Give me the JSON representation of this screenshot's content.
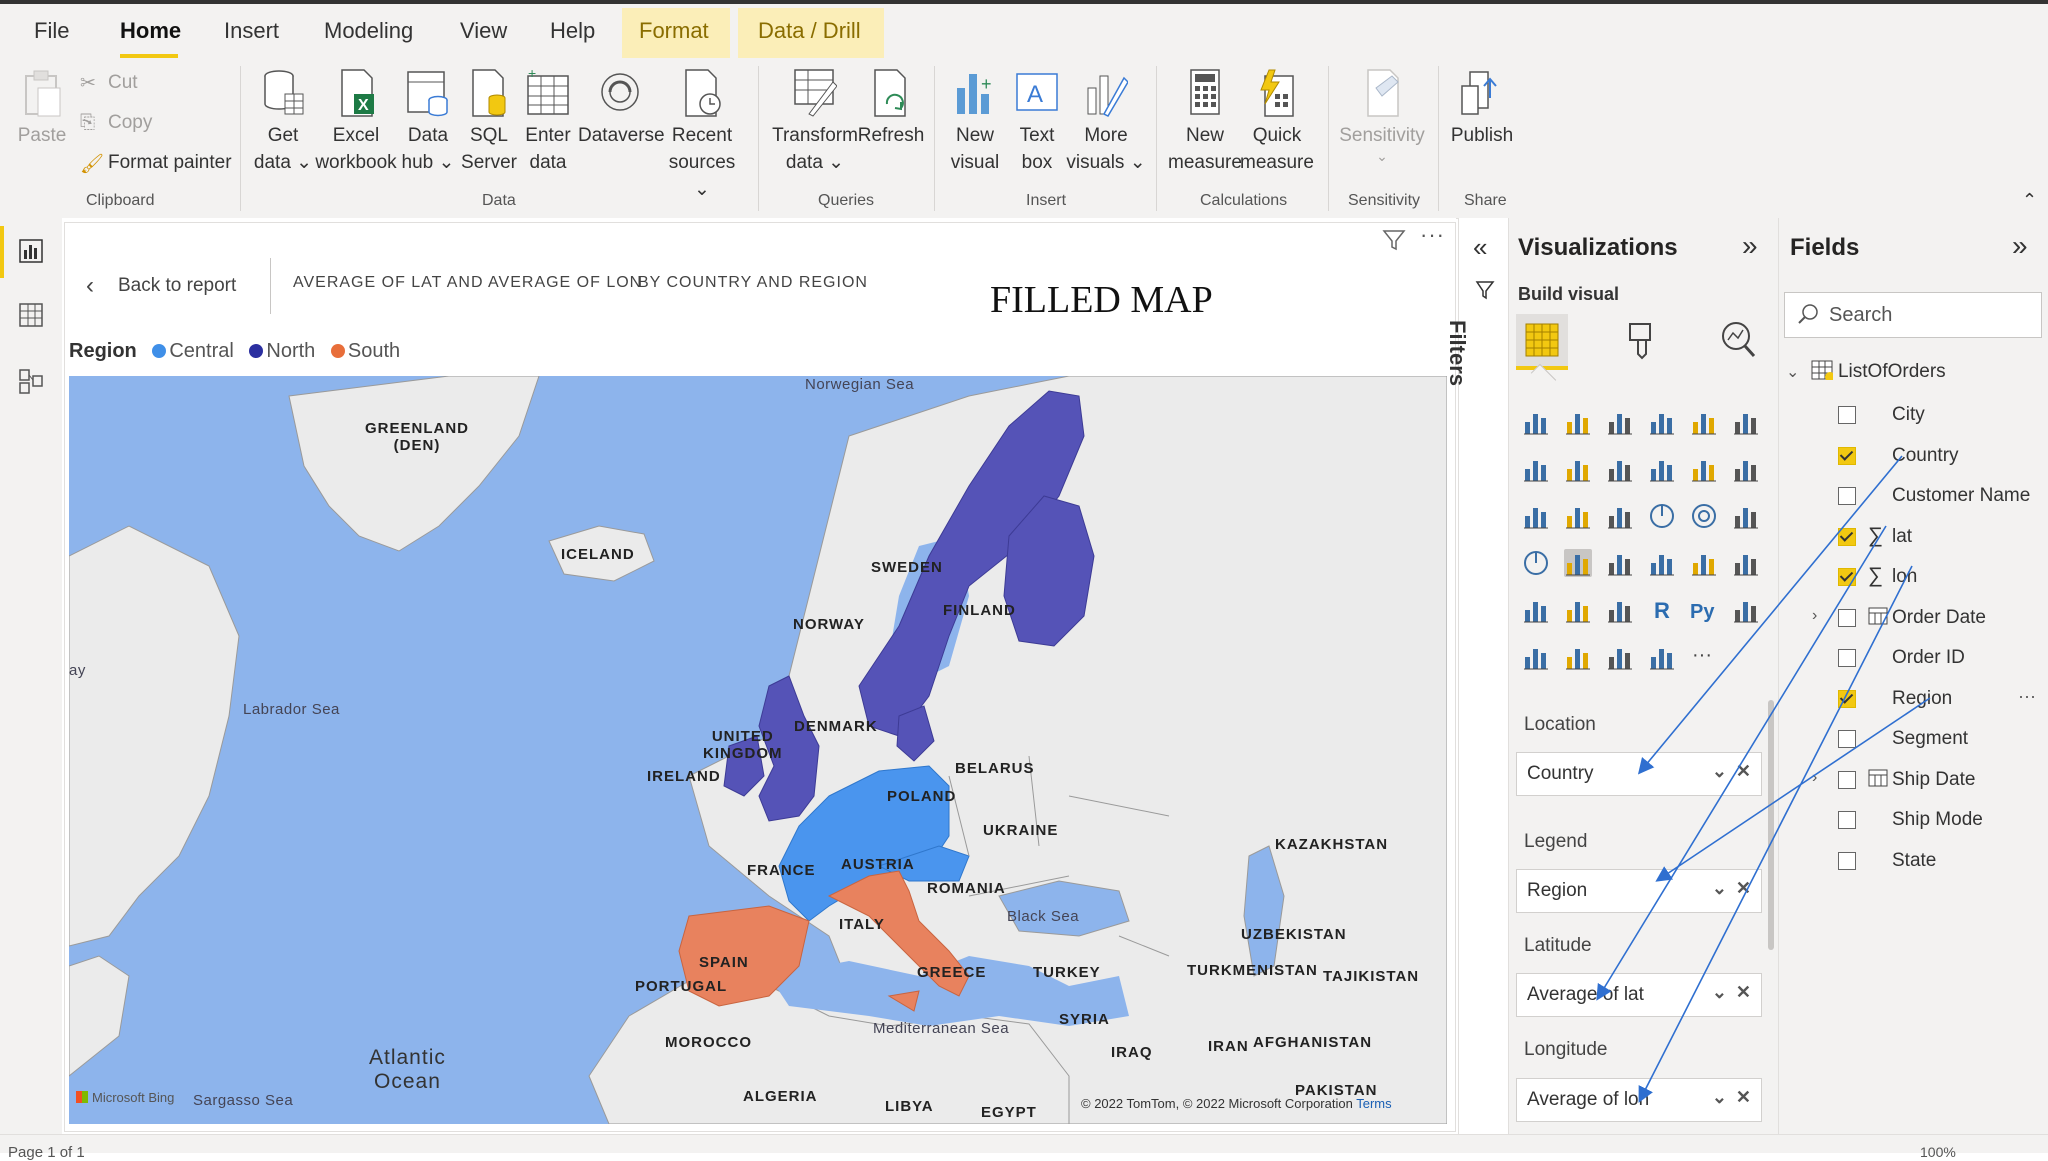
{
  "menu": {
    "items": [
      "File",
      "Home",
      "Insert",
      "Modeling",
      "View",
      "Help",
      "Format",
      "Data / Drill"
    ],
    "active": "Home"
  },
  "ribbon": {
    "clipboard": {
      "paste": "Paste",
      "cut": "Cut",
      "copy": "Copy",
      "format_painter": "Format painter",
      "label": "Clipboard"
    },
    "data": {
      "get_data": [
        "Get",
        "data ⌄"
      ],
      "excel": [
        "Excel",
        "workbook"
      ],
      "data_hub": [
        "Data",
        "hub ⌄"
      ],
      "sql": [
        "SQL",
        "Server"
      ],
      "enter": [
        "Enter",
        "data"
      ],
      "dataverse": [
        "Dataverse"
      ],
      "recent": [
        "Recent",
        "sources ⌄"
      ],
      "label": "Data"
    },
    "queries": {
      "transform": [
        "Transform",
        "data ⌄"
      ],
      "refresh": [
        "Refresh"
      ],
      "label": "Queries"
    },
    "insert": {
      "new_visual": [
        "New",
        "visual"
      ],
      "text_box": [
        "Text",
        "box"
      ],
      "more_visuals": [
        "More",
        "visuals ⌄"
      ],
      "label": "Insert"
    },
    "calculations": {
      "new_measure": [
        "New",
        "measure"
      ],
      "quick_measure": [
        "Quick",
        "measure"
      ],
      "label": "Calculations"
    },
    "sensitivity": {
      "btn": [
        "Sensitivity",
        "⌄"
      ],
      "label": "Sensitivity"
    },
    "share": {
      "publish": [
        "Publish"
      ],
      "label": "Share"
    }
  },
  "report": {
    "back": "Back to report",
    "crumb1": "AVERAGE OF LAT AND AVERAGE OF LON",
    "crumb2": "BY COUNTRY AND REGION",
    "title": "FILLED MAP",
    "legend_title": "Region",
    "legend": [
      {
        "name": "Central",
        "color": "#3f8fe8"
      },
      {
        "name": "North",
        "color": "#2b2fa0"
      },
      {
        "name": "South",
        "color": "#e86e3a"
      }
    ]
  },
  "map": {
    "colors": {
      "water": "#8db4ec",
      "land": "#ebebeb",
      "north": "#5553b7",
      "central": "#4a95ee",
      "south": "#e8825e",
      "border": "#9a9a9a"
    },
    "labels": {
      "norwegian_sea": "Norwegian Sea",
      "greenland": "GREENLAND\n(DEN)",
      "iceland": "ICELAND",
      "sweden": "SWEDEN",
      "finland": "FINLAND",
      "norway": "NORWAY",
      "labrador": "Labrador Sea",
      "ay": "ay",
      "denmark": "DENMARK",
      "uk": "UNITED\nKINGDOM",
      "ireland": "IRELAND",
      "belarus": "BELARUS",
      "poland": "POLAND",
      "ukraine": "UKRAINE",
      "kazakhstan": "KAZAKHSTAN",
      "france": "FRANCE",
      "austria": "AUSTRIA",
      "romania": "ROMANIA",
      "black_sea": "Black Sea",
      "uzbekistan": "UZBEKISTAN",
      "italy": "ITALY",
      "spain": "SPAIN",
      "portugal": "PORTUGAL",
      "greece": "GREECE",
      "turkey": "TURKEY",
      "turkmenistan": "TURKMENISTAN",
      "tajikistan": "TAJIKISTAN",
      "atlantic": "Atlantic\nOcean",
      "morocco": "MOROCCO",
      "mediterranean": "Mediterranean Sea",
      "syria": "SYRIA",
      "iran": "IRAN",
      "afghanistan": "AFGHANISTAN",
      "iraq": "IRAQ",
      "pakistan": "PAKISTAN",
      "sargasso": "Sargasso Sea",
      "algeria": "ALGERIA",
      "libya": "LIBYA",
      "egypt": "EGYPT"
    },
    "attribution": "© 2022 TomTom, © 2022 Microsoft Corporation",
    "terms": "Terms",
    "bing": "Microsoft Bing"
  },
  "filters": {
    "label": "Filters"
  },
  "visualizations": {
    "title": "Visualizations",
    "build": "Build visual",
    "wells": [
      {
        "label": "Location",
        "value": "Country"
      },
      {
        "label": "Legend",
        "value": "Region"
      },
      {
        "label": "Latitude",
        "value": "Average of lat"
      },
      {
        "label": "Longitude",
        "value": "Average of lon"
      }
    ]
  },
  "fields": {
    "title": "Fields",
    "search_placeholder": "Search",
    "table": "ListOfOrders",
    "items": [
      {
        "name": "City",
        "checked": false
      },
      {
        "name": "Country",
        "checked": true
      },
      {
        "name": "Customer Name",
        "checked": false
      },
      {
        "name": "lat",
        "checked": true,
        "sigma": true
      },
      {
        "name": "lon",
        "checked": true,
        "sigma": true
      },
      {
        "name": "Order Date",
        "checked": false,
        "date": true
      },
      {
        "name": "Order ID",
        "checked": false
      },
      {
        "name": "Region",
        "checked": true
      },
      {
        "name": "Segment",
        "checked": false
      },
      {
        "name": "Ship Date",
        "checked": false,
        "date": true
      },
      {
        "name": "Ship Mode",
        "checked": false
      },
      {
        "name": "State",
        "checked": false
      }
    ]
  },
  "status": {
    "page": "Page 1 of 1",
    "zoom": "100%"
  }
}
